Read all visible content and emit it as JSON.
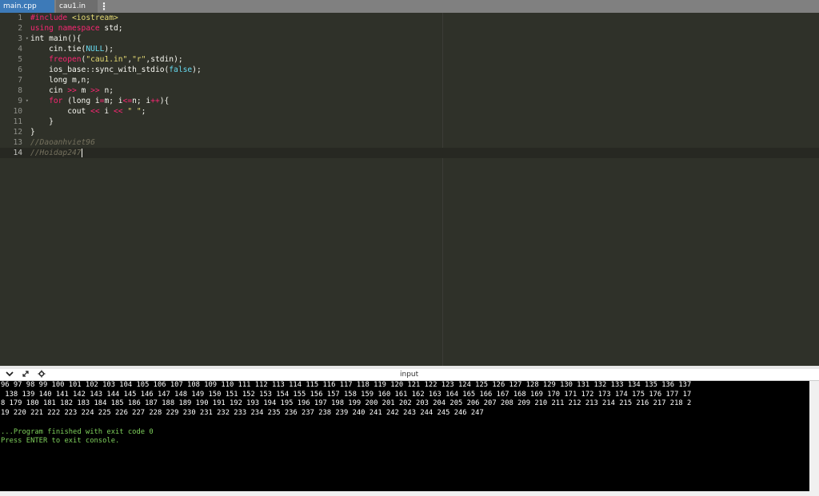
{
  "tabs": [
    {
      "label": "main.cpp",
      "active": true
    },
    {
      "label": "cau1.in",
      "active": false
    }
  ],
  "tab_menu_icon": "vertical-dots-icon",
  "editor": {
    "line_numbers": [
      "1",
      "2",
      "3",
      "4",
      "5",
      "6",
      "7",
      "8",
      "9",
      "10",
      "11",
      "12",
      "13",
      "14"
    ],
    "fold_lines": [
      3,
      9
    ],
    "active_line": 14
  },
  "io_panel": {
    "title": "input",
    "icons": [
      "chevron-down-icon",
      "expand-icon",
      "settings-icon"
    ]
  },
  "console": {
    "output_lines": [
      "96 97 98 99 100 101 102 103 104 105 106 107 108 109 110 111 112 113 114 115 116 117 118 119 120 121 122 123 124 125 126 127 128 129 130 131 132 133 134 135 136 137",
      " 138 139 140 141 142 143 144 145 146 147 148 149 150 151 152 153 154 155 156 157 158 159 160 161 162 163 164 165 166 167 168 169 170 171 172 173 174 175 176 177 17",
      "8 179 180 181 182 183 184 185 186 187 188 189 190 191 192 193 194 195 196 197 198 199 200 201 202 203 204 205 206 207 208 209 210 211 212 213 214 215 216 217 218 2",
      "19 220 221 222 223 224 225 226 227 228 229 230 231 232 233 234 235 236 237 238 239 240 241 242 243 244 245 246 247"
    ],
    "status_line_1": "...Program finished with exit code 0",
    "status_line_2": "Press ENTER to exit console."
  },
  "colors": {
    "editor_bg": "#2f3129",
    "active_tab": "#3d7ab8",
    "console_bg": "#000000",
    "console_status": "#7fd15c"
  }
}
